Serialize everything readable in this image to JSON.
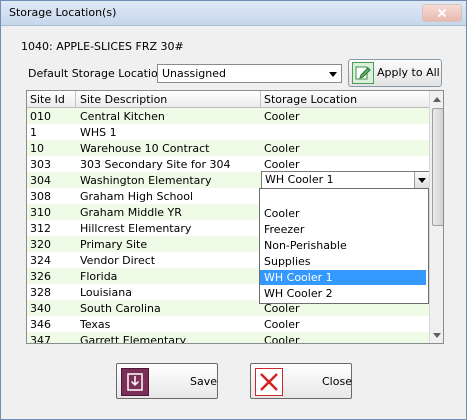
{
  "window": {
    "title": "Storage Location(s)"
  },
  "item": {
    "title": "1040: APPLE-SLICES FRZ 30#"
  },
  "default_storage": {
    "label": "Default Storage Location:",
    "value": "Unassigned"
  },
  "apply_button": {
    "label": "Apply to All",
    "icon": "edit-icon"
  },
  "grid": {
    "columns": [
      "Site Id",
      "Site Description",
      "Storage Location"
    ],
    "rows": [
      [
        "010",
        "Central Kitchen",
        "Cooler"
      ],
      [
        "1",
        "WHS 1",
        ""
      ],
      [
        "10",
        "Warehouse 10 Contract",
        "Cooler"
      ],
      [
        "303",
        "303 Secondary Site for 304",
        "Cooler"
      ],
      [
        "304",
        "Washington Elementary",
        "WH Cooler 1"
      ],
      [
        "308",
        "Graham High School",
        ""
      ],
      [
        "310",
        "Graham Middle YR",
        ""
      ],
      [
        "312",
        "Hillcrest Elementary",
        ""
      ],
      [
        "320",
        "Primary Site",
        ""
      ],
      [
        "324",
        "Vendor Direct",
        ""
      ],
      [
        "326",
        "Florida",
        ""
      ],
      [
        "328",
        "Louisiana",
        ""
      ],
      [
        "340",
        "South Carolina",
        "Cooler"
      ],
      [
        "346",
        "Texas",
        "Cooler"
      ],
      [
        "347",
        "Garrett Elementary",
        "Cooler"
      ]
    ],
    "editing_value": "WH Cooler 1"
  },
  "dropdown": {
    "options": [
      "",
      "Cooler",
      "Freezer",
      "Non-Perishable",
      "Supplies",
      "WH Cooler 1",
      "WH Cooler 2"
    ],
    "selected": "WH Cooler 1"
  },
  "buttons": {
    "save": "Save",
    "close": "Close"
  },
  "colors": {
    "row_alt": "#eefbe6",
    "selection": "#3399ff",
    "save_icon": "#7c2f56",
    "close_icon": "#cc2a2a"
  }
}
